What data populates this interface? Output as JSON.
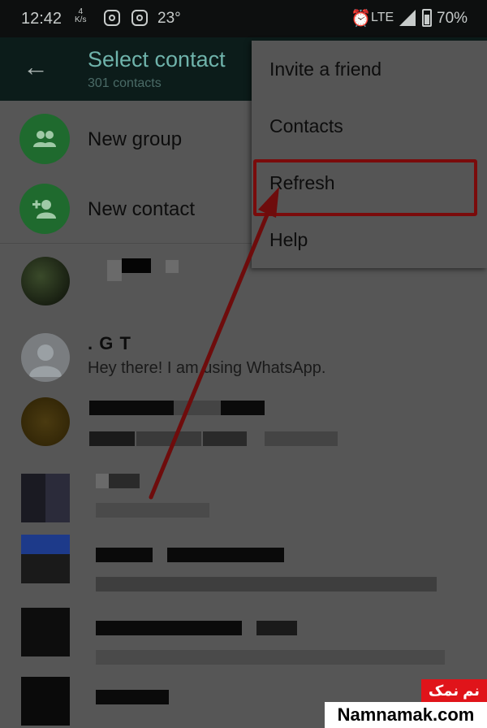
{
  "status_bar": {
    "time": "12:42",
    "data_badge_top": "4",
    "data_badge_bottom": "K/s",
    "temperature": "23°",
    "network": "LTE",
    "battery": "70%"
  },
  "app_bar": {
    "title": "Select contact",
    "subtitle": "301 contacts",
    "back_icon": "arrow-left-icon"
  },
  "actions": {
    "new_group": "New group",
    "new_contact": "New contact",
    "new_group_icon": "group-icon",
    "new_contact_icon": "add-person-icon"
  },
  "contacts": [
    {
      "name": "",
      "status": ""
    },
    {
      "name": ". G T",
      "status": "Hey there! I am using WhatsApp."
    },
    {
      "name": "",
      "status": ""
    },
    {
      "name": "",
      "status": ""
    },
    {
      "name": "",
      "status": ""
    },
    {
      "name": "",
      "status": ""
    },
    {
      "name": "",
      "status": ""
    }
  ],
  "menu": {
    "items": [
      "Invite a friend",
      "Contacts",
      "Refresh",
      "Help"
    ],
    "highlighted_item": "Refresh"
  },
  "watermark": {
    "persian": "نم نمک",
    "site": "Namnamak.com"
  },
  "colors": {
    "accent_green": "#1f6a2e",
    "highlight_red": "#7a0b0b",
    "title_teal": "#6fb3ab"
  }
}
